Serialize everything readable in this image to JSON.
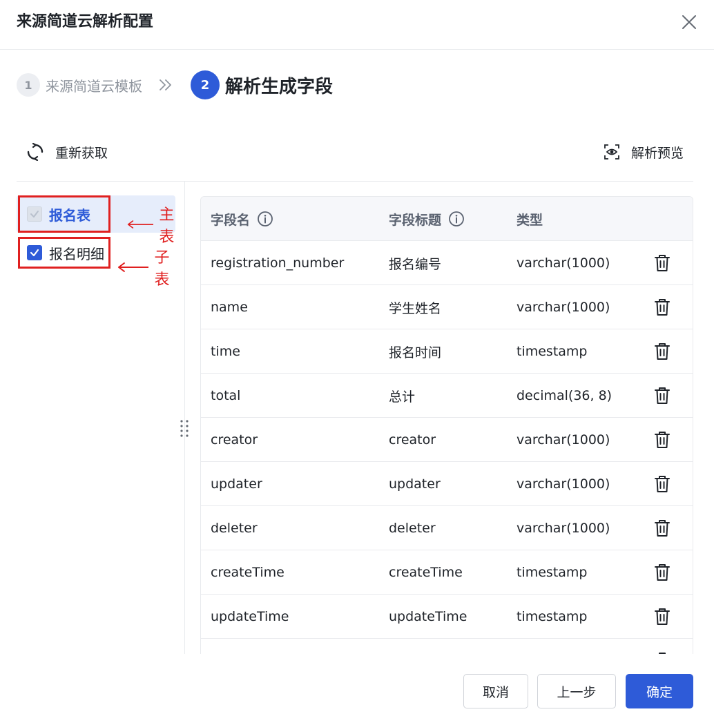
{
  "dialog": {
    "title": "来源简道云解析配置"
  },
  "steps": [
    {
      "number": "1",
      "label": "来源简道云模板"
    },
    {
      "number": "2",
      "label": "解析生成字段"
    }
  ],
  "toolbar": {
    "refresh_label": "重新获取",
    "preview_label": "解析预览"
  },
  "tree": {
    "items": [
      {
        "label": "报名表",
        "checked": true,
        "disabled": true,
        "selected": true
      },
      {
        "label": "报名明细",
        "checked": true,
        "disabled": false,
        "selected": false
      }
    ]
  },
  "annotations": {
    "main_table": "主表",
    "sub_table": "子表"
  },
  "table": {
    "headers": {
      "field_name": "字段名",
      "field_title": "字段标题",
      "type": "类型"
    },
    "rows": [
      {
        "name": "registration_number",
        "title": "报名编号",
        "type": "varchar(1000)"
      },
      {
        "name": "name",
        "title": "学生姓名",
        "type": "varchar(1000)"
      },
      {
        "name": "time",
        "title": "报名时间",
        "type": "timestamp"
      },
      {
        "name": "total",
        "title": "总计",
        "type": "decimal(36, 8)"
      },
      {
        "name": "creator",
        "title": "creator",
        "type": "varchar(1000)"
      },
      {
        "name": "updater",
        "title": "updater",
        "type": "varchar(1000)"
      },
      {
        "name": "deleter",
        "title": "deleter",
        "type": "varchar(1000)"
      },
      {
        "name": "createTime",
        "title": "createTime",
        "type": "timestamp"
      },
      {
        "name": "updateTime",
        "title": "updateTime",
        "type": "timestamp"
      }
    ]
  },
  "footer": {
    "cancel_label": "取消",
    "prev_label": "上一步",
    "ok_label": "确定"
  },
  "colors": {
    "primary": "#2e5bd8",
    "annotation": "#e02020",
    "selected_bg": "#e6edfb"
  }
}
